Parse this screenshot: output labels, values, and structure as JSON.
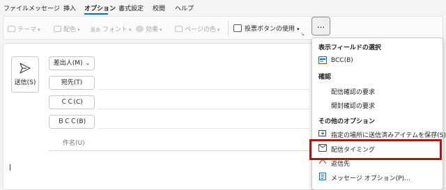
{
  "tabs": [
    {
      "label": "ファイル"
    },
    {
      "label": "メッセージ"
    },
    {
      "label": "挿入"
    },
    {
      "label": "オプション"
    },
    {
      "label": "書式設定"
    },
    {
      "label": "校閲"
    },
    {
      "label": "ヘルプ"
    }
  ],
  "ribbon": {
    "theme": "テーマ",
    "color": "配色",
    "font": "フォント",
    "effect": "効果",
    "page_color": "ページの色",
    "font_prefix": "亜あ",
    "vote_buttons": "投票ボタンの使用",
    "more": "..."
  },
  "compose": {
    "send": "送信(S)",
    "from": "差出人(M)",
    "to": "宛先(T)",
    "cc": "ＣＣ(C)",
    "bcc": "ＢＣＣ(B)",
    "subject": "件名(U)"
  },
  "menu": {
    "show_fields_header": "表示フィールドの選択",
    "bcc_item": "BCC(B)",
    "tracking_header": "確認",
    "delivery_receipt": "配信確認の要求",
    "read_receipt": "開封確認の要求",
    "more_options_header": "その他のオプション",
    "save_sent_to": "指定の場所に送信済みアイテムを保存(S)",
    "delay_delivery": "配信タイミング",
    "direct_replies": "返信先",
    "message_options": "メッセージ オプション(P)..."
  },
  "colors": {
    "accent": "#0f6cbd",
    "highlight": "#b31212"
  }
}
